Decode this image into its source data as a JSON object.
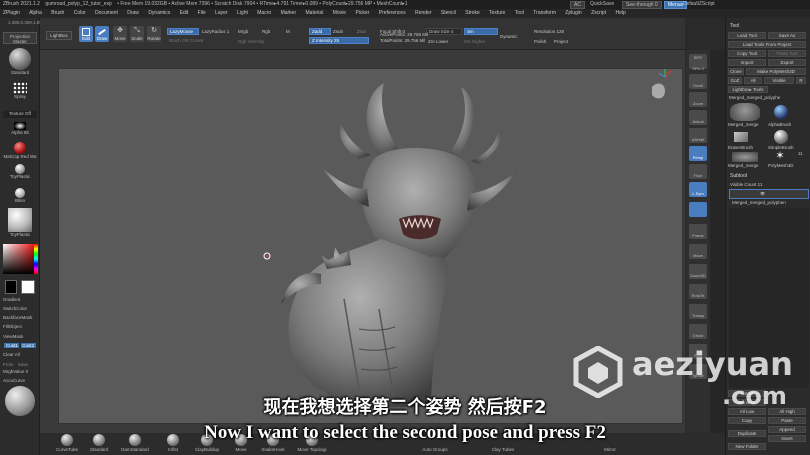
{
  "titlebar": {
    "app": "ZBrush 2021.1.2",
    "file": "gumroad_polyp_12_tutor_exp",
    "stats": "• Free Mem 19.032GB • Active Mem 7396 • Scratch Disk 7904 • RTime▸4.791 Timer▸0.089 • PolyCount▸29.756 MP • MeshCount▸1",
    "ac": "AC",
    "quicksave": "QuickSave",
    "see_through": "See-through 0",
    "menus": "Menus",
    "default_script": "DefaultZScript"
  },
  "menubar": [
    "Alpha",
    "Brush",
    "Color",
    "Document",
    "Draw",
    "Dynamics",
    "Edit",
    "File",
    "Layer",
    "Light",
    "Macro",
    "Marker",
    "Material",
    "Movie",
    "Picker",
    "Preferences",
    "Render",
    "Stencil",
    "Stroke",
    "Texture",
    "Tool",
    "Transform",
    "Zplugin",
    "Zscript",
    "Help"
  ],
  "menubar_prefix": "ZPlugin",
  "toolbar": {
    "projection_master": "Projection Master",
    "lightbox": "LightBox",
    "edit": "Edit",
    "draw": "Draw",
    "move": "Move",
    "scale": "Scale",
    "rotate": "Rotate",
    "lazymouse": "LazyMouse",
    "lazyradius": "LazyRadius 1",
    "brush_cursor": "Brush OR Cursor",
    "mrgb": "Mrgb",
    "rgb": "Rgb",
    "m": "M",
    "rgb_intensity": "Rgb Intensity",
    "zadd": "Zadd",
    "zsub": "Zsub",
    "zcut": "Zcut",
    "z_intensity": "Z Intensity 25",
    "focal_shift": "Focal Shift 0",
    "draw_size": "Draw Size 4",
    "dynamic": "Dynamic",
    "active_points": "ActivePoints: 29.756 Mil",
    "total_points": "TotalPoints: 29.756 Mil",
    "sm": "Sm",
    "zre_lower": "Zre Lower",
    "zre_higher": "Zre Higher",
    "dynamesh": "DynaMesh",
    "resolution": "Resolution 128",
    "polish": "Polish",
    "project": "Project"
  },
  "leftshelf": {
    "standard": "Standard",
    "spray": "Spray",
    "texture_off": "Texture Off",
    "alpha": "Alpha 55",
    "matcap": "MatCap Red Wa",
    "toyplastic": "ToyPlastic",
    "blinn": "Blinn",
    "toyplastic2": "ToyPlastic",
    "gradient": "Gradient",
    "switch_color": "SwitchColor",
    "backface_mask": "BackfaceMask",
    "fill_object": "FillObject",
    "viewmask": "ViewMask",
    "cust1": "Cust1",
    "cust2": "Cust2",
    "clear_all": "Clear All",
    "from": "From",
    "save": "Save",
    "mrgb_value": "MrgbValue 0",
    "accucurve": "AccuCurve",
    "coords": "1.385,0.359,1.851"
  },
  "rightshelf": [
    "BPR",
    "SPix 3",
    "Scroll",
    "Zoom",
    "Actual",
    "AAHalf",
    "Persp",
    "Floor",
    "L.Sym",
    "Frame",
    "Move",
    "Zoom3D",
    "RotaTe",
    "Transp",
    "Ghost",
    "Solo",
    "Xpose"
  ],
  "panel": {
    "title": "Tool",
    "load_tool": "Load Tool",
    "save_as": "Save As",
    "load_tools_from_project": "Load Tools From Project",
    "copy_tool": "Copy Tool",
    "paste_tool": "Paste Tool",
    "import": "Import",
    "export": "Export",
    "clone": "Clone",
    "make_polymesh": "Make PolyMesh3D",
    "goz": "GoZ",
    "all": "All",
    "visible": "Visible",
    "r": "R",
    "lightbox_tools": "Lightbox▸ Tools",
    "current_tool": "Merged_merged_polyphe",
    "tools": [
      "Merged_merge",
      "AlphaBrush",
      "SimpleBrush",
      "EraserBrush",
      "PolyMesh3D",
      "Merged_merge"
    ],
    "tool_count": "11",
    "subtool_title": "Subtool",
    "visible_count": "Visible Count 11",
    "subtool_items": [
      "Merged_merged_polyphen",
      "Merged_merged_polyphen"
    ],
    "bottom_buttons": [
      "List All",
      "Rename",
      "All Low",
      "Copy",
      "Duplicate",
      "New Folder",
      "Auto Reorder",
      "All High",
      "Paste",
      "Append",
      "Insert"
    ]
  },
  "bottombar": [
    "CurveTube",
    "Standard",
    "DamStandard",
    "Inflat",
    "ClayBuildup",
    "Move",
    "SnakeHook",
    "Move Topologi",
    "Auto Groups",
    "Clay Tubes",
    "Mirror"
  ],
  "subtitles": {
    "zh": "现在我想选择第二个姿势 然后按F2",
    "en": "Now I want to select the second pose and press F2"
  },
  "watermark": {
    "line1": "aeziyuan",
    ".com": ".com"
  },
  "colors": {
    "accent": "#4a7dc0",
    "viewport": "#5a5a5a",
    "panel_bg": "#2b2b2b",
    "subtitle": "#ffffff"
  }
}
